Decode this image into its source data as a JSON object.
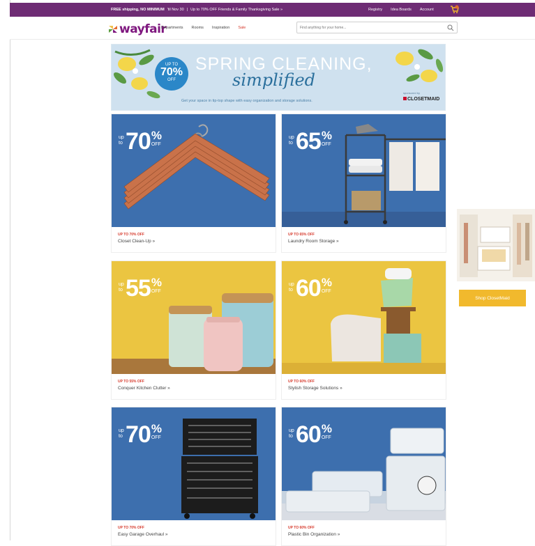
{
  "promo": {
    "free_shipping_bold": "FREE shipping, NO MINIMUM",
    "free_shipping_rest": "'til Nov 30",
    "separator": "|",
    "sale_text": "Up to 70% OFF Friends & Family Thanksgiving Sale »",
    "links": [
      "Registry",
      "Idea Boards",
      "Account"
    ]
  },
  "header": {
    "logo": "wayfair",
    "nav": [
      "Departments",
      "Rooms",
      "Inspiration",
      "Sale"
    ],
    "search_placeholder": "Find anything for your home..."
  },
  "hero": {
    "badge": {
      "line1": "UP TO",
      "line2": "70%",
      "line3": "OFF"
    },
    "title": "SPRING CLEANING,",
    "subtitle": "simplified",
    "tagline": "Get your space in tip-top shape with easy organization and storage solutions.",
    "sponsor_label": "sponsored by",
    "sponsor": "CLOSETMAID"
  },
  "cards": [
    {
      "upto": "up to",
      "percent": "70",
      "eyebrow": "UP TO 70% OFF",
      "link": "Closet Clean-Up »"
    },
    {
      "upto": "up to",
      "percent": "65",
      "eyebrow": "UP TO 65% OFF",
      "link": "Laundry Room Storage »"
    },
    {
      "upto": "up to",
      "percent": "55",
      "eyebrow": "UP TO 55% OFF",
      "link": "Conquer Kitchen Clutter »"
    },
    {
      "upto": "up to",
      "percent": "60",
      "eyebrow": "UP TO 60% OFF",
      "link": "Stylish Storage Solutions »"
    },
    {
      "upto": "up to",
      "percent": "70",
      "eyebrow": "UP TO 70% OFF",
      "link": "Easy Garage Overhaul »"
    },
    {
      "upto": "up to",
      "percent": "60",
      "eyebrow": "UP TO 60% OFF",
      "link": "Plastic Bin Organization »"
    }
  ],
  "card_common": {
    "psym": "%",
    "off": "OFF"
  },
  "side_ad": {
    "button": "Shop ClosetMaid"
  },
  "colors": {
    "brand_purple": "#7f187f",
    "promo_bar": "#6e2c74",
    "sale_red": "#d63a2c",
    "tile_blue": "#3d6fae",
    "tile_yellow": "#ebc541",
    "cta_yellow": "#f1b92d"
  }
}
